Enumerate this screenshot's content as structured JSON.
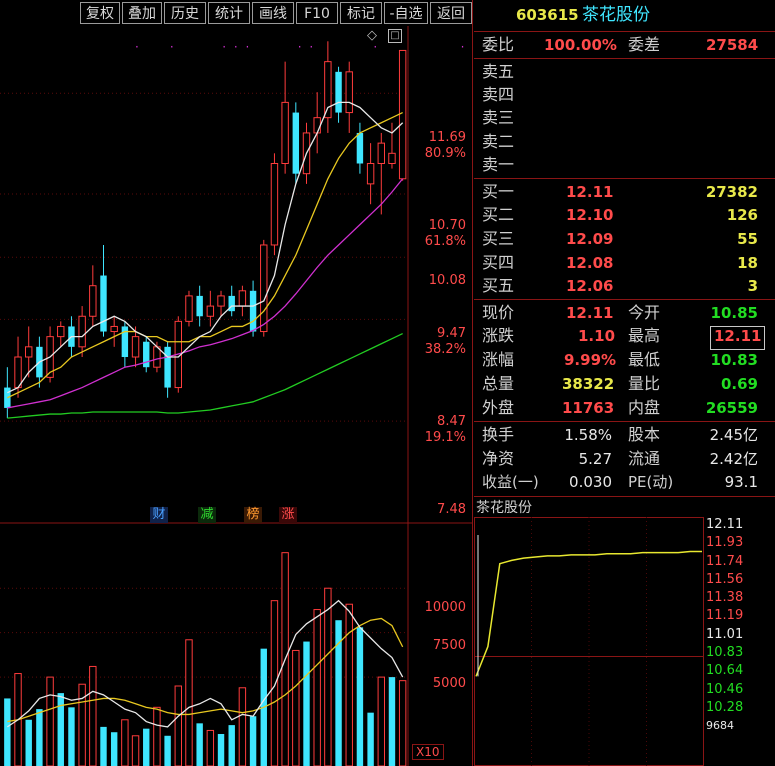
{
  "toolbar": {
    "buttons": [
      "复权",
      "叠加",
      "历史",
      "统计",
      "画线",
      "F10",
      "标记",
      "-自选",
      "返回"
    ]
  },
  "stock": {
    "code": "603615",
    "name": "茶花股份"
  },
  "order_book": {
    "webi_label": "委比",
    "webi_value": "100.00%",
    "weicha_label": "委差",
    "weicha_value": "27584",
    "sell_labels": [
      "卖五",
      "卖四",
      "卖三",
      "卖二",
      "卖一"
    ],
    "buy": [
      {
        "label": "买一",
        "price": "12.11",
        "vol": "27382"
      },
      {
        "label": "买二",
        "price": "12.10",
        "vol": "126"
      },
      {
        "label": "买三",
        "price": "12.09",
        "vol": "55"
      },
      {
        "label": "买四",
        "price": "12.08",
        "vol": "18"
      },
      {
        "label": "买五",
        "price": "12.06",
        "vol": "3"
      }
    ]
  },
  "quote": {
    "rows": [
      {
        "l1": "现价",
        "v1": "12.11",
        "l2": "今开",
        "v2": "10.85"
      },
      {
        "l1": "涨跌",
        "v1": "1.10",
        "l2": "最高",
        "v2": "12.11"
      },
      {
        "l1": "涨幅",
        "v1": "9.99%",
        "l2": "最低",
        "v2": "10.83"
      },
      {
        "l1": "总量",
        "v1": "38322",
        "l2": "量比",
        "v2": "0.69"
      },
      {
        "l1": "外盘",
        "v1": "11763",
        "l2": "内盘",
        "v2": "26559"
      }
    ]
  },
  "fundamentals": {
    "rows": [
      {
        "l1": "换手",
        "v1": "1.58%",
        "l2": "股本",
        "v2": "2.45亿"
      },
      {
        "l1": "净资",
        "v1": "5.27",
        "l2": "流通",
        "v2": "2.42亿"
      },
      {
        "l1": "收益(一)",
        "v1": "0.030",
        "l2": "PE(动)",
        "v2": "93.1"
      }
    ]
  },
  "intraday": {
    "title": "茶花股份",
    "price_ticks": [
      "12.11",
      "11.93",
      "11.74",
      "11.56",
      "11.38",
      "11.19",
      "11.01",
      "10.83",
      "10.64",
      "10.46",
      "10.28"
    ],
    "volume_tick": "9684"
  },
  "kline": {
    "price_axis": [
      {
        "price": "11.69",
        "pct": "80.9%"
      },
      {
        "price": "10.70",
        "pct": "61.8%"
      },
      {
        "price": "10.08",
        "pct": ""
      },
      {
        "price": "9.47",
        "pct": "38.2%"
      },
      {
        "price": "8.47",
        "pct": "19.1%"
      },
      {
        "price": "7.48",
        "pct": ""
      }
    ],
    "badges": [
      "财",
      "减",
      "榜",
      "涨"
    ],
    "volume_axis": [
      "10000",
      "7500",
      "5000"
    ],
    "volume_unit": "X10",
    "candles": [
      [
        8.6,
        8.8,
        8.5,
        9.0,
        0
      ],
      [
        8.8,
        9.1,
        8.7,
        9.3,
        1
      ],
      [
        9.1,
        9.2,
        8.9,
        9.4,
        1
      ],
      [
        9.2,
        8.9,
        8.8,
        9.3,
        0
      ],
      [
        8.9,
        9.3,
        8.85,
        9.4,
        1
      ],
      [
        9.3,
        9.4,
        9.2,
        9.45,
        1
      ],
      [
        9.4,
        9.2,
        9.1,
        9.5,
        0
      ],
      [
        9.2,
        9.5,
        9.1,
        9.6,
        1
      ],
      [
        9.5,
        9.8,
        9.4,
        10.0,
        1
      ],
      [
        9.9,
        9.35,
        9.3,
        10.2,
        0
      ],
      [
        9.35,
        9.4,
        9.2,
        9.5,
        1
      ],
      [
        9.4,
        9.1,
        9.0,
        9.45,
        0
      ],
      [
        9.1,
        9.3,
        9.0,
        9.4,
        1
      ],
      [
        9.25,
        9.0,
        8.95,
        9.3,
        0
      ],
      [
        9.0,
        9.2,
        8.95,
        9.25,
        1
      ],
      [
        9.2,
        8.8,
        8.7,
        9.25,
        0
      ],
      [
        8.8,
        9.45,
        8.75,
        9.5,
        1
      ],
      [
        9.45,
        9.7,
        9.4,
        9.75,
        1
      ],
      [
        9.7,
        9.5,
        9.4,
        9.8,
        0
      ],
      [
        9.5,
        9.6,
        9.4,
        9.75,
        1
      ],
      [
        9.6,
        9.7,
        9.5,
        9.75,
        1
      ],
      [
        9.7,
        9.55,
        9.5,
        9.8,
        0
      ],
      [
        9.6,
        9.75,
        9.5,
        9.8,
        1
      ],
      [
        9.75,
        9.35,
        9.3,
        9.85,
        0
      ],
      [
        9.35,
        10.2,
        9.3,
        10.25,
        1
      ],
      [
        10.2,
        11.0,
        10.1,
        11.1,
        1
      ],
      [
        11.0,
        11.6,
        10.9,
        12.0,
        1
      ],
      [
        11.5,
        10.9,
        10.8,
        11.6,
        0
      ],
      [
        10.9,
        11.3,
        10.8,
        11.4,
        1
      ],
      [
        11.3,
        11.45,
        11.1,
        11.7,
        1
      ],
      [
        11.45,
        12.0,
        11.3,
        12.2,
        1
      ],
      [
        11.9,
        11.5,
        11.4,
        11.95,
        0
      ],
      [
        11.5,
        11.9,
        11.3,
        12.0,
        1
      ],
      [
        11.3,
        11.0,
        10.9,
        11.4,
        0
      ],
      [
        11.0,
        10.8,
        10.6,
        11.2,
        1
      ],
      [
        11.0,
        11.2,
        10.5,
        11.3,
        1
      ],
      [
        11.1,
        11.0,
        10.95,
        11.4,
        1
      ],
      [
        10.85,
        12.11,
        10.83,
        12.11,
        1
      ]
    ],
    "volumes": [
      3800,
      5200,
      2600,
      3200,
      5000,
      4100,
      3300,
      4600,
      5600,
      2200,
      1900,
      2600,
      1700,
      2100,
      3300,
      1700,
      4500,
      7100,
      2400,
      2000,
      1800,
      2300,
      4400,
      2800,
      6600,
      9300,
      12000,
      6500,
      7000,
      8800,
      10000,
      8200,
      9100,
      7800,
      3000,
      5000,
      5000,
      4800
    ],
    "volume_colors": [
      0,
      1,
      0,
      0,
      1,
      0,
      0,
      1,
      1,
      0,
      0,
      1,
      1,
      0,
      1,
      0,
      1,
      1,
      0,
      1,
      0,
      0,
      1,
      0,
      0,
      1,
      1,
      1,
      0,
      1,
      1,
      0,
      1,
      0,
      0,
      1,
      0,
      1
    ],
    "ma5": [
      8.75,
      8.8,
      8.95,
      9.05,
      9.1,
      9.2,
      9.3,
      9.3,
      9.4,
      9.45,
      9.5,
      9.45,
      9.35,
      9.3,
      9.2,
      9.1,
      9.1,
      9.2,
      9.3,
      9.35,
      9.5,
      9.6,
      9.6,
      9.6,
      9.65,
      9.9,
      10.4,
      10.8,
      11.1,
      11.3,
      11.55,
      11.6,
      11.6,
      11.55,
      11.45,
      11.35,
      11.3,
      11.4
    ],
    "ma10": [
      8.7,
      8.75,
      8.8,
      8.85,
      8.95,
      9.0,
      9.1,
      9.15,
      9.2,
      9.25,
      9.3,
      9.35,
      9.35,
      9.3,
      9.3,
      9.25,
      9.25,
      9.25,
      9.3,
      9.3,
      9.35,
      9.4,
      9.4,
      9.45,
      9.55,
      9.7,
      9.9,
      10.1,
      10.35,
      10.6,
      10.85,
      11.05,
      11.2,
      11.3,
      11.35,
      11.4,
      11.45,
      11.5
    ],
    "ma20": [
      8.6,
      8.62,
      8.64,
      8.66,
      8.68,
      8.72,
      8.76,
      8.8,
      8.85,
      8.9,
      8.95,
      9.0,
      9.02,
      9.05,
      9.08,
      9.1,
      9.13,
      9.16,
      9.2,
      9.22,
      9.25,
      9.28,
      9.32,
      9.36,
      9.42,
      9.5,
      9.6,
      9.72,
      9.85,
      9.98,
      10.1,
      10.2,
      10.3,
      10.4,
      10.5,
      10.6,
      10.72,
      10.85
    ],
    "ma60": [
      8.5,
      8.51,
      8.52,
      8.53,
      8.54,
      8.54,
      8.55,
      8.55,
      8.56,
      8.56,
      8.56,
      8.56,
      8.56,
      8.56,
      8.56,
      8.55,
      8.55,
      8.56,
      8.57,
      8.58,
      8.6,
      8.62,
      8.64,
      8.66,
      8.7,
      8.74,
      8.78,
      8.83,
      8.88,
      8.93,
      8.98,
      9.03,
      9.08,
      9.13,
      9.18,
      9.23,
      9.28,
      9.33
    ],
    "vol_ma5": [
      2200,
      2600,
      3100,
      3800,
      4000,
      3900,
      3700,
      3800,
      4200,
      4000,
      3600,
      3200,
      3000,
      2500,
      2300,
      2200,
      2800,
      3300,
      3500,
      3800,
      3500,
      2600,
      2900,
      2800,
      3700,
      4500,
      6000,
      7400,
      8000,
      8400,
      8800,
      9300,
      8700,
      7800,
      7200,
      6600,
      6100,
      5000
    ],
    "vol_ma10": [
      2500,
      2600,
      2800,
      3000,
      3200,
      3400,
      3500,
      3600,
      3700,
      3800,
      3800,
      3700,
      3500,
      3300,
      3200,
      3000,
      2900,
      2900,
      3000,
      3100,
      3200,
      3100,
      3000,
      3100,
      3300,
      3600,
      4000,
      4500,
      5100,
      5700,
      6300,
      6900,
      7500,
      7900,
      8200,
      8300,
      7900,
      6700
    ],
    "intraday_line": [
      10.83,
      11.1,
      11.85,
      11.88,
      11.9,
      11.91,
      11.92,
      11.92,
      11.93,
      11.93,
      11.93,
      11.94,
      11.94,
      11.94,
      11.95,
      11.95,
      11.95,
      11.95,
      11.96,
      11.96
    ]
  }
}
